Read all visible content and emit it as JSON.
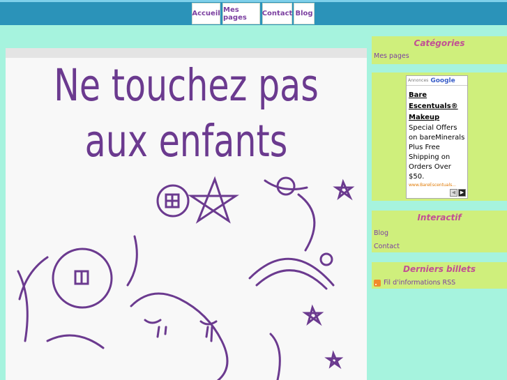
{
  "nav": {
    "items": [
      "Accueil",
      "Mes pages",
      "Contact",
      "Blog"
    ]
  },
  "hero": {
    "line1": "Ne touchez pas",
    "line2": "aux enfants"
  },
  "sidebar": {
    "categories": {
      "title": "Catégories",
      "links": [
        "Mes pages"
      ]
    },
    "ad": {
      "header": "Annonces",
      "brand": "Google",
      "title": "Bare Escentuals® Makeup",
      "body": "Special Offers on bareMinerals Plus Free Shipping on Orders Over $50.",
      "url": "www.BareEscentuals..."
    },
    "interactif": {
      "title": "Interactif",
      "links": [
        "Blog",
        "Contact"
      ]
    },
    "billets": {
      "title": "Derniers billets",
      "rss": "Fil d'informations RSS"
    }
  },
  "colors": {
    "background": "#a6f3de",
    "navbar": "#2b93b9",
    "widget": "#cfef7c",
    "title": "#c14f94",
    "link": "#7b3fa0"
  }
}
